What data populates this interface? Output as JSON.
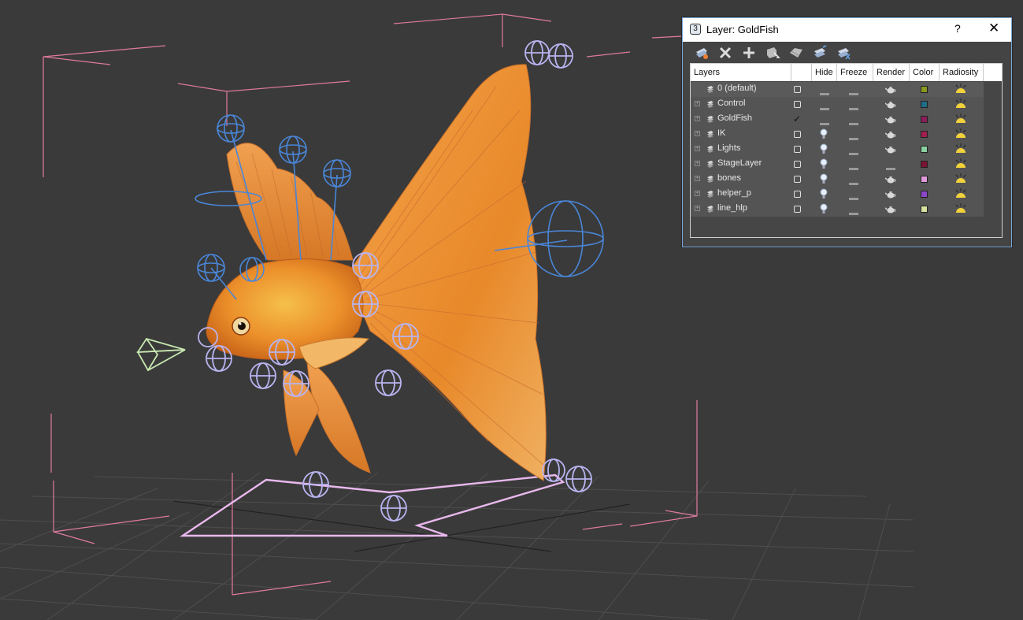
{
  "dialog": {
    "title": "Layer: GoldFish",
    "help_label": "?",
    "close_label": "✕",
    "toolbar": [
      {
        "name": "create-new-layer-button",
        "icon": "new-layer-icon"
      },
      {
        "name": "delete-layer-button",
        "icon": "delete-x-icon"
      },
      {
        "name": "add-to-layer-button",
        "icon": "plus-icon"
      },
      {
        "name": "select-objects-button",
        "icon": "select-objects-icon"
      },
      {
        "name": "highlight-layer-button",
        "icon": "highlight-icon"
      },
      {
        "name": "hide-all-layers-button",
        "icon": "hide-all-icon"
      },
      {
        "name": "freeze-all-layers-button",
        "icon": "freeze-all-icon"
      }
    ]
  },
  "table": {
    "columns": [
      "Layers",
      "Hide",
      "Freeze",
      "Render",
      "Color",
      "Radiosity"
    ],
    "rows": [
      {
        "name": "0 (default)",
        "active": false,
        "expandable": false,
        "hide": "dash",
        "freeze": "dash",
        "render": "teapot",
        "color": "#8a9a1e"
      },
      {
        "name": "Control",
        "active": false,
        "expandable": true,
        "hide": "dash",
        "freeze": "dash",
        "render": "teapot",
        "color": "#1e6e88"
      },
      {
        "name": "GoldFish",
        "active": true,
        "expandable": true,
        "hide": "dash",
        "freeze": "dash",
        "render": "teapot",
        "color": "#8a1e5a"
      },
      {
        "name": "IK",
        "active": false,
        "expandable": true,
        "hide": "bulb",
        "freeze": "dash",
        "render": "teapot",
        "color": "#a01e50"
      },
      {
        "name": "Lights",
        "active": false,
        "expandable": true,
        "hide": "bulb",
        "freeze": "dash",
        "render": "teapot",
        "color": "#8ad0a0"
      },
      {
        "name": "StageLayer",
        "active": false,
        "expandable": true,
        "hide": "bulb",
        "freeze": "dash",
        "render": "dash",
        "color": "#7a1432"
      },
      {
        "name": "bones",
        "active": false,
        "expandable": true,
        "hide": "bulb",
        "freeze": "dash",
        "render": "teapot",
        "color": "#e09ad8"
      },
      {
        "name": "helper_p",
        "active": false,
        "expandable": true,
        "hide": "bulb",
        "freeze": "dash",
        "render": "teapot",
        "color": "#8a46c8"
      },
      {
        "name": "line_hlp",
        "active": false,
        "expandable": true,
        "hide": "bulb",
        "freeze": "dash",
        "render": "teapot",
        "color": "#d6e2a0"
      }
    ]
  },
  "viewport": {
    "background": "#3a3a3a",
    "bbox_color": "#e07aa0",
    "helper_color": "#b8b4f0",
    "control_color": "#4a86d8",
    "camera_color": "#c8e8b0",
    "fish_color": "#e88a2a"
  }
}
